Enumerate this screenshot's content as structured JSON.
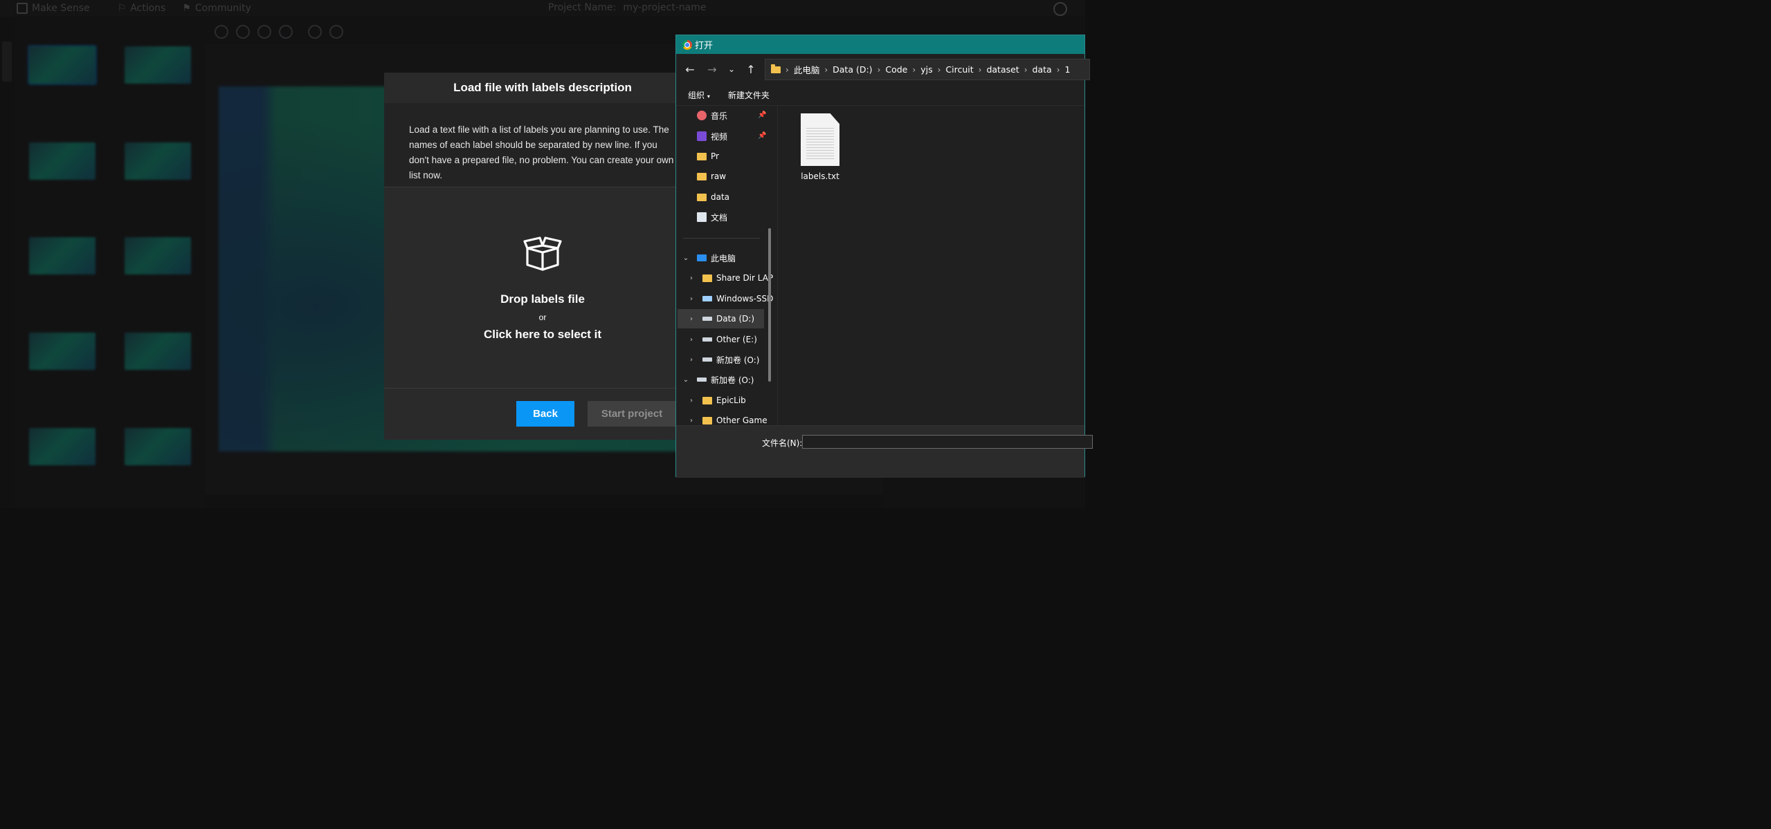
{
  "app": {
    "menu": [
      "Make Sense",
      "Actions",
      "Community"
    ],
    "project_label": "Project Name:",
    "project_name": "my-project-name"
  },
  "modal": {
    "title": "Load file with labels description",
    "description": "Load a text file with a list of labels you are planning to use. The names of each label should be separated by new line. If you don't have a prepared file, no problem. You can create your own list now.",
    "drop_title": "Drop labels file",
    "drop_or": "or",
    "drop_click": "Click here to select it",
    "back_label": "Back",
    "start_label": "Start project"
  },
  "dialog": {
    "title": "打开",
    "breadcrumb": [
      "此电脑",
      "Data (D:)",
      "Code",
      "yjs",
      "Circuit",
      "dataset",
      "data",
      "1"
    ],
    "commands": {
      "organize": "组织",
      "new_folder": "新建文件夹"
    },
    "nav_items": [
      {
        "label": "音乐",
        "icon": "music-icon",
        "pinned": true
      },
      {
        "label": "视频",
        "icon": "video-icon",
        "pinned": true
      },
      {
        "label": "Pr",
        "icon": "folder-icon"
      },
      {
        "label": "raw",
        "icon": "folder-icon"
      },
      {
        "label": "data",
        "icon": "folder-icon"
      },
      {
        "label": "文档",
        "icon": "document-icon"
      },
      {
        "label": "此电脑",
        "icon": "this-pc-icon",
        "expanded": true
      },
      {
        "label": "Share Dir LAP",
        "icon": "folder-icon"
      },
      {
        "label": "Windows-SSD",
        "icon": "drive-icon"
      },
      {
        "label": "Data (D:)",
        "icon": "drive-icon",
        "selected": true
      },
      {
        "label": "Other (E:)",
        "icon": "drive-icon"
      },
      {
        "label": "新加卷 (O:)",
        "icon": "drive-icon"
      },
      {
        "label": "新加卷 (O:)",
        "icon": "drive-icon",
        "expanded": true
      },
      {
        "label": "EpicLib",
        "icon": "folder-icon"
      },
      {
        "label": "Other Game",
        "icon": "folder-icon"
      }
    ],
    "files": [
      {
        "name": "labels.txt",
        "icon": "text-file-icon"
      }
    ],
    "filename_label": "文件名(N):",
    "filename_value": ""
  },
  "colors": {
    "accent": "#0a96f5",
    "dialog_title_bar": "#0e7c7b",
    "modal_bg": "#2a2a2b"
  }
}
